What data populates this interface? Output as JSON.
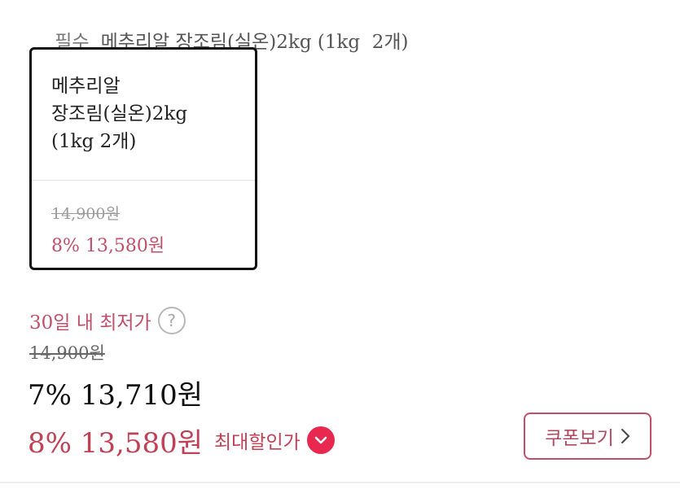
{
  "header": {
    "tag": "필수",
    "product_title": "메추리알 장조림(실온)2kg (1kg  2개)"
  },
  "option_card": {
    "name": "메추리알\n장조림(실온)2kg\n(1kg  2개)",
    "original_price": "14,900원",
    "sale_price": "8% 13,580원"
  },
  "pricing": {
    "lowest_label": "30일 내 최저가",
    "help_icon": "question-circle-icon",
    "original_price": "14,900원",
    "current_price": "7% 13,710원",
    "max_discount_price": "8% 13,580원",
    "max_discount_label": "최대할인가",
    "max_discount_icon": "chevron-down-icon"
  },
  "coupon": {
    "label": "쿠폰보기",
    "icon": "chevron-right-icon"
  },
  "colors": {
    "accent": "#c0506a",
    "badge": "#e8284f"
  }
}
